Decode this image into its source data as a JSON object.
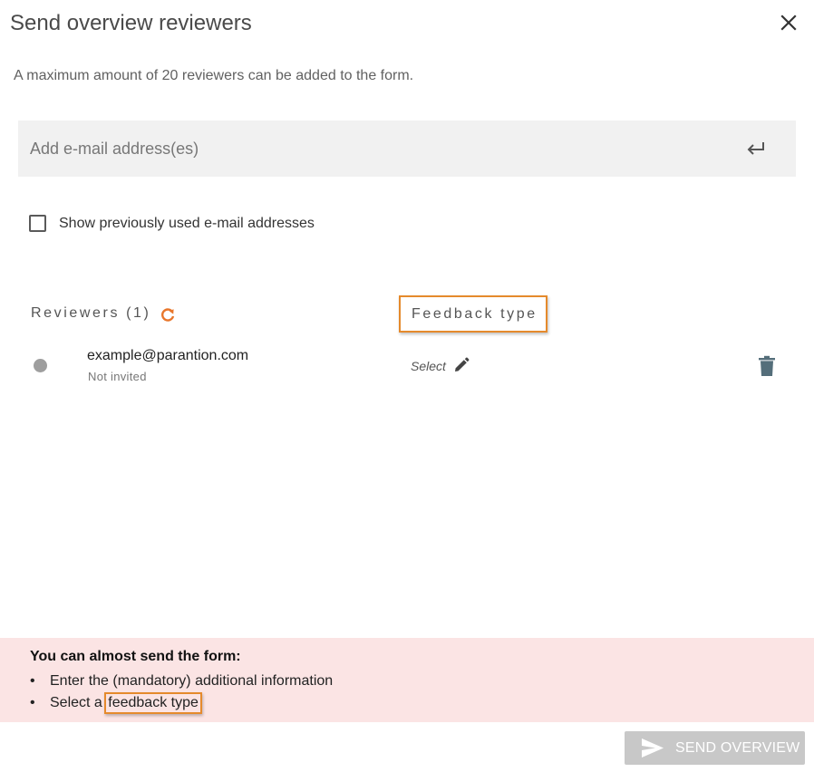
{
  "dialog": {
    "title": "Send overview reviewers",
    "description": "A maximum amount of 20 reviewers can be added to the form."
  },
  "email_input": {
    "placeholder": "Add e-mail address(es)",
    "value": "",
    "submit_icon": "enter-return-icon"
  },
  "show_previous": {
    "label": "Show previously used e-mail addresses",
    "checked": false
  },
  "reviewers": {
    "header": "Reviewers (1)",
    "feedback_header": "Feedback type",
    "refresh_icon": "refresh-icon",
    "items": [
      {
        "email": "example@parantion.com",
        "status": "Not invited",
        "feedback_type": "Select",
        "edit_icon": "pencil-icon",
        "delete_icon": "trash-icon"
      }
    ]
  },
  "notice": {
    "title": "You can almost send the form:",
    "items": [
      {
        "text": "Enter the (mandatory) additional information"
      },
      {
        "prefix": "Select a ",
        "highlight": "feedback type"
      }
    ]
  },
  "actions": {
    "send_label": "SEND OVERVIEW",
    "send_icon": "send-icon",
    "send_enabled": false
  },
  "colors": {
    "highlight_border": "#e58a2c",
    "refresh_icon": "#e8762b",
    "notice_background": "#fbe4e4",
    "send_button_disabled": "#c8c8c8",
    "trash_icon": "#546e7a",
    "status_dot": "#9e9e9e"
  }
}
